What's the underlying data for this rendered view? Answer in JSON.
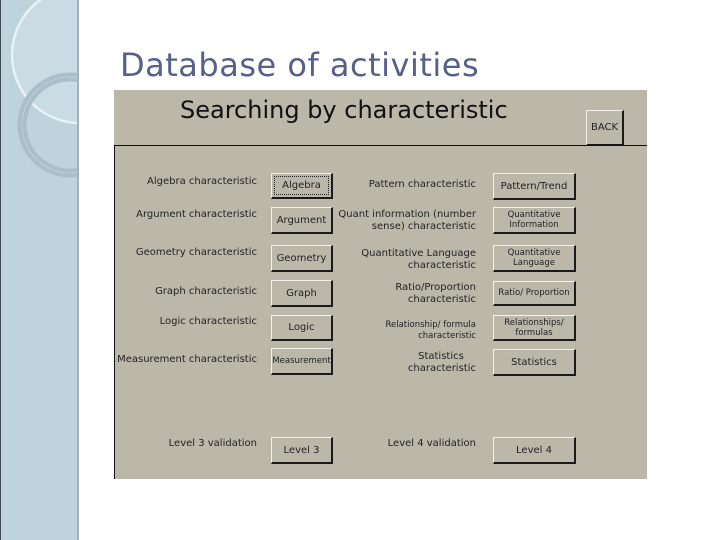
{
  "slide": {
    "title": "Database of activities"
  },
  "form": {
    "heading": "Searching by characteristic",
    "back_label": "BACK",
    "left_column": [
      {
        "label": "Algebra characteristic",
        "button": "Algebra"
      },
      {
        "label": "Argument characteristic",
        "button": "Argument"
      },
      {
        "label": "Geometry characteristic",
        "button": "Geometry"
      },
      {
        "label": "Graph characteristic",
        "button": "Graph"
      },
      {
        "label": "Logic characteristic",
        "button": "Logic"
      },
      {
        "label": "Measurement characteristic",
        "button": "Measurement"
      }
    ],
    "right_column": [
      {
        "label": "Pattern characteristic",
        "button": "Pattern/Trend"
      },
      {
        "label_line1": "Quant information (number",
        "label_line2": "sense) characteristic",
        "button_line1": "Quantitative",
        "button_line2": "Information"
      },
      {
        "label_line1": "Quantitative Language",
        "label_line2": "characteristic",
        "button_line1": "Quantitative",
        "button_line2": "Language"
      },
      {
        "label_line1": "Ratio/Proportion",
        "label_line2": "characteristic",
        "button": "Ratio/ Proportion"
      },
      {
        "label_line1": "Relationship/ formula",
        "label_line2": "characteristic",
        "button_line1": "Relationships/",
        "button_line2": "formulas"
      },
      {
        "label_line1": "Statistics",
        "label_line2": "characteristic",
        "button": "Statistics"
      }
    ],
    "validation": [
      {
        "label": "Level 3 validation",
        "button": "Level 3"
      },
      {
        "label": "Level 4 validation",
        "button": "Level 4"
      }
    ]
  }
}
